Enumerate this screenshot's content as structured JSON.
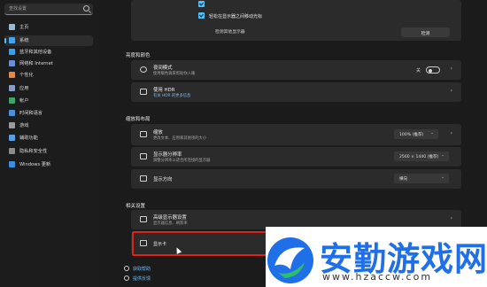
{
  "sidebar": {
    "search_placeholder": "查找设置",
    "items": [
      {
        "label": "主页",
        "icon": "home-icon",
        "color": "#9bb7d4"
      },
      {
        "label": "系统",
        "icon": "system-icon",
        "color": "#4aa3e8"
      },
      {
        "label": "蓝牙和其他设备",
        "icon": "bluetooth-icon",
        "color": "#3b9ee8"
      },
      {
        "label": "网络和 Internet",
        "icon": "network-icon",
        "color": "#6a8fd8"
      },
      {
        "label": "个性化",
        "icon": "personalization-icon",
        "color": "#e08a4a"
      },
      {
        "label": "应用",
        "icon": "apps-icon",
        "color": "#8a9bc8"
      },
      {
        "label": "帐户",
        "icon": "accounts-icon",
        "color": "#3fa46a"
      },
      {
        "label": "时间和语言",
        "icon": "time-language-icon",
        "color": "#4a90d9"
      },
      {
        "label": "游戏",
        "icon": "gaming-icon",
        "color": "#9a9a9a"
      },
      {
        "label": "辅助功能",
        "icon": "accessibility-icon",
        "color": "#5aa0e0"
      },
      {
        "label": "隐私和安全性",
        "icon": "privacy-icon",
        "color": "#8a8a8a"
      },
      {
        "label": "Windows 更新",
        "icon": "windows-update-icon",
        "color": "#3d8de0"
      }
    ],
    "active_index": 1
  },
  "multi_display": {
    "check1_label": "",
    "check2_label": "轻松在显示器之间移动光标",
    "detect_label": "检测其他显示器",
    "detect_button": "检测"
  },
  "brightness": {
    "section_title": "亮度和颜色",
    "night_light_title": "夜间模式",
    "night_light_sub": "使用暖色调来帮助你入睡",
    "night_light_state": "关",
    "hdr_title": "使用 HDR",
    "hdr_sub": "有关 HDR 的更多信息"
  },
  "scale_layout": {
    "section_title": "缩放和布局",
    "scale_title": "缩放",
    "scale_sub": "更改文本、应用和其他项的大小",
    "scale_value": "100% (推荐)",
    "resolution_title": "显示器分辨率",
    "resolution_sub": "调整分辨率以适合所连接的显示器",
    "resolution_value": "2560 × 1440 (推荐)",
    "orientation_title": "显示方向",
    "orientation_value": "横向"
  },
  "related": {
    "section_title": "相关设置",
    "advanced_title": "高级显示器设置",
    "advanced_sub": "显示器信息、刷新率",
    "graphics_title": "显示卡"
  },
  "footer_links": {
    "help": "获取帮助",
    "feedback": "提供反馈"
  },
  "watermark": {
    "text": "安勤游戏网",
    "url": "www.hzaccw.com",
    "color": "#1e6fe8"
  },
  "colors": {
    "accent": "#4cc2ff",
    "highlight": "#e2201b"
  }
}
